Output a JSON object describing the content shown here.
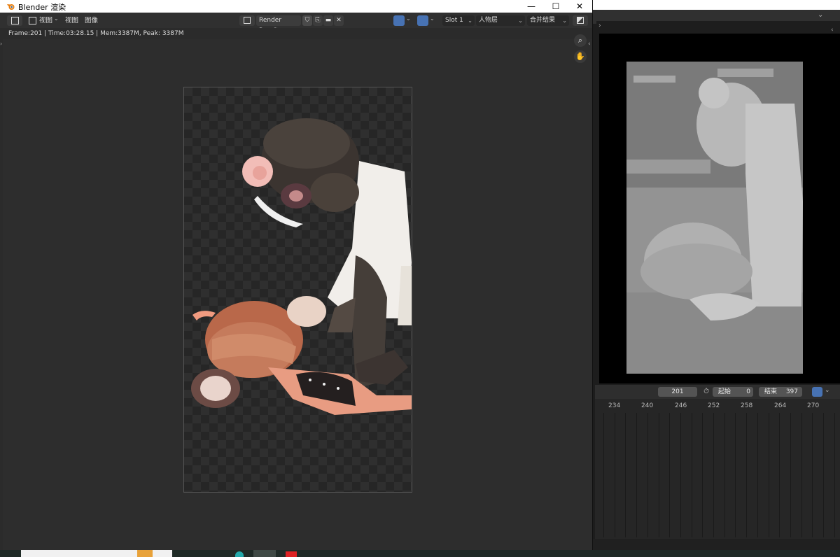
{
  "window": {
    "title": "Blender 渲染",
    "minimize": "—",
    "maximize": "☐",
    "close": "✕"
  },
  "header": {
    "menu_view": "视图",
    "menu_view2": "视图",
    "menu_image": "图像",
    "image_name": "Render Result",
    "slot": "Slot 1",
    "view_layer": "人物层",
    "pass": "合并结果"
  },
  "stats": "Frame:201 | Time:03:28.15 | Mem:3387M, Peak: 3387M",
  "timeline": {
    "current_frame": "201",
    "start_label": "起始",
    "start_value": "0",
    "end_label": "结束",
    "end_value": "397",
    "ticks": [
      "234",
      "240",
      "246",
      "252",
      "258",
      "264",
      "270"
    ]
  },
  "icons": {
    "logo": "blender-logo-icon",
    "zoom": "zoom-icon",
    "hand": "hand-icon"
  },
  "colors": {
    "accent": "#4772b3",
    "panel": "#303030",
    "canvas": "#2b2b2b"
  }
}
